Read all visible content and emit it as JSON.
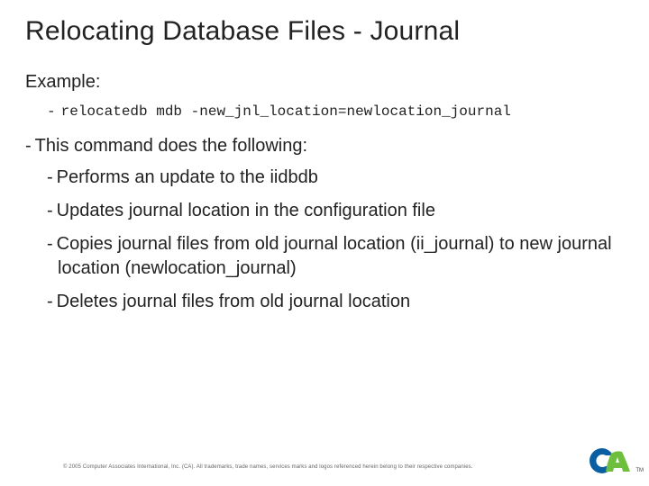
{
  "title": "Relocating Database Files - Journal",
  "example_label": "Example:",
  "code": "relocatedb mdb -new_jnl_location=newlocation_journal",
  "intro": "This command does the following:",
  "bullets": [
    "Performs an update to the iidbdb",
    "Updates journal location in the configuration file",
    "Copies journal files from old journal location (ii_journal) to new journal location (newlocation_journal)",
    "Deletes journal files from old journal location"
  ],
  "copyright": "© 2005 Computer Associates International, Inc. (CA). All trademarks, trade names, services marks and logos referenced herein belong to their respective companies.",
  "logo_name": "ca",
  "tm": "TM"
}
